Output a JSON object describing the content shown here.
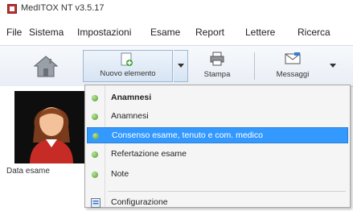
{
  "window": {
    "title": "MedITOX NT v3.5.17"
  },
  "menubar": {
    "items": [
      "File",
      "Sistema",
      "Impostazioni",
      "Esame",
      "Report",
      "Lettere",
      "Ricerca"
    ]
  },
  "toolbar": {
    "new_exam_label": "Nuovo elemento",
    "print_label": "Stampa",
    "messages_label": "Messaggi"
  },
  "patient": {
    "label": "Data esame"
  },
  "dropdown": {
    "items": [
      {
        "label": "Anamnesi",
        "bold": true
      },
      {
        "label": "Anamnesi"
      },
      {
        "label": "Consenso esame, tenuto e com. medico",
        "selected": true
      },
      {
        "label": "Refertazione esame"
      },
      {
        "label": "Note"
      }
    ],
    "settings_label": "Configurazione"
  },
  "colors": {
    "highlight": "#3399ff",
    "bullet": "#4f9a2c",
    "app_icon": "#b8312f"
  }
}
